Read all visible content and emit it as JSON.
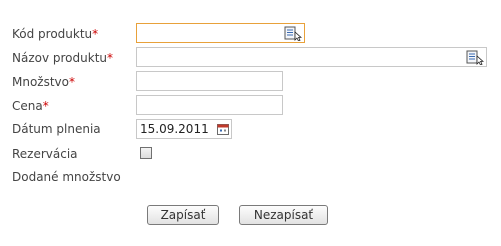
{
  "form": {
    "product_code": {
      "label": "Kód produktu",
      "required_mark": "*",
      "value": ""
    },
    "product_name": {
      "label": "Názov produktu",
      "required_mark": "*",
      "value": ""
    },
    "quantity": {
      "label": "Množstvo",
      "required_mark": "*",
      "value": ""
    },
    "price": {
      "label": "Cena",
      "required_mark": "*",
      "value": ""
    },
    "fulfillment_date": {
      "label": "Dátum plnenia",
      "value": "15.09.2011"
    },
    "reservation": {
      "label": "Rezervácia",
      "checked": false
    },
    "delivered_quantity": {
      "label": "Dodané množstvo",
      "value": ""
    }
  },
  "buttons": {
    "save": "Zapísať",
    "cancel": "Nezapísať"
  },
  "icons": {
    "lookup": "lookup-list-icon",
    "calendar": "calendar-icon"
  },
  "colors": {
    "required": "#cc0000",
    "focus_border": "#e8a13a",
    "calendar_accent": "#c0392b"
  }
}
